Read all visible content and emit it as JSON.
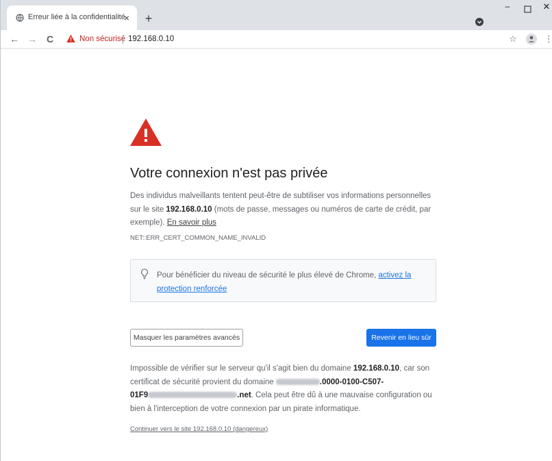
{
  "browser": {
    "tab": {
      "title": "Erreur liée à la confidentialité",
      "close": "×"
    },
    "new_tab": "+",
    "window": {
      "minimize": "–",
      "close": "✕"
    },
    "toolbar": {
      "back": "←",
      "forward": "→",
      "reload": "C",
      "security_label": "Non sécurisé",
      "url": "192.168.0.10",
      "star": "☆",
      "menu": "⋮"
    }
  },
  "page": {
    "heading": "Votre connexion n'est pas privée",
    "intro": {
      "before": "Des individus malveillants tentent peut-être de subtiliser vos informations personnelles sur le site ",
      "host": "192.168.0.10",
      "after": " (mots de passe, messages ou numéros de carte de crédit, par exemple). ",
      "link": "En savoir plus"
    },
    "error_code": "NET::ERR_CERT_COMMON_NAME_INVALID",
    "tip": {
      "text": "Pour bénéficier du niveau de sécurité le plus élevé de Chrome, ",
      "link": "activez la protection renforcée"
    },
    "buttons": {
      "advanced": "Masquer les paramètres avancés",
      "back_to_safety": "Revenir en lieu sûr"
    },
    "details": {
      "p1": "Impossible de vérifier sur le serveur qu'il s'agit bien du domaine ",
      "host": "192.168.0.10",
      "p2": ", car son certificat de sécurité provient du domaine ",
      "cert_part1": ".0000-0100-C507-",
      "cert_part2": "01F9",
      "cert_part3": ".net",
      "p3": ". Cela peut être dû à une mauvaise configuration ou bien à l'interception de votre connexion par un pirate informatique."
    },
    "proceed_link": "Continuer vers le site 192.168.0.10 (dangereux)"
  },
  "icons": {
    "tab_favicon": "globe-icon",
    "warning": "warning-triangle-icon",
    "tip": "lightbulb-icon"
  },
  "colors": {
    "danger": "#d93025",
    "primary": "#1a73e8"
  }
}
